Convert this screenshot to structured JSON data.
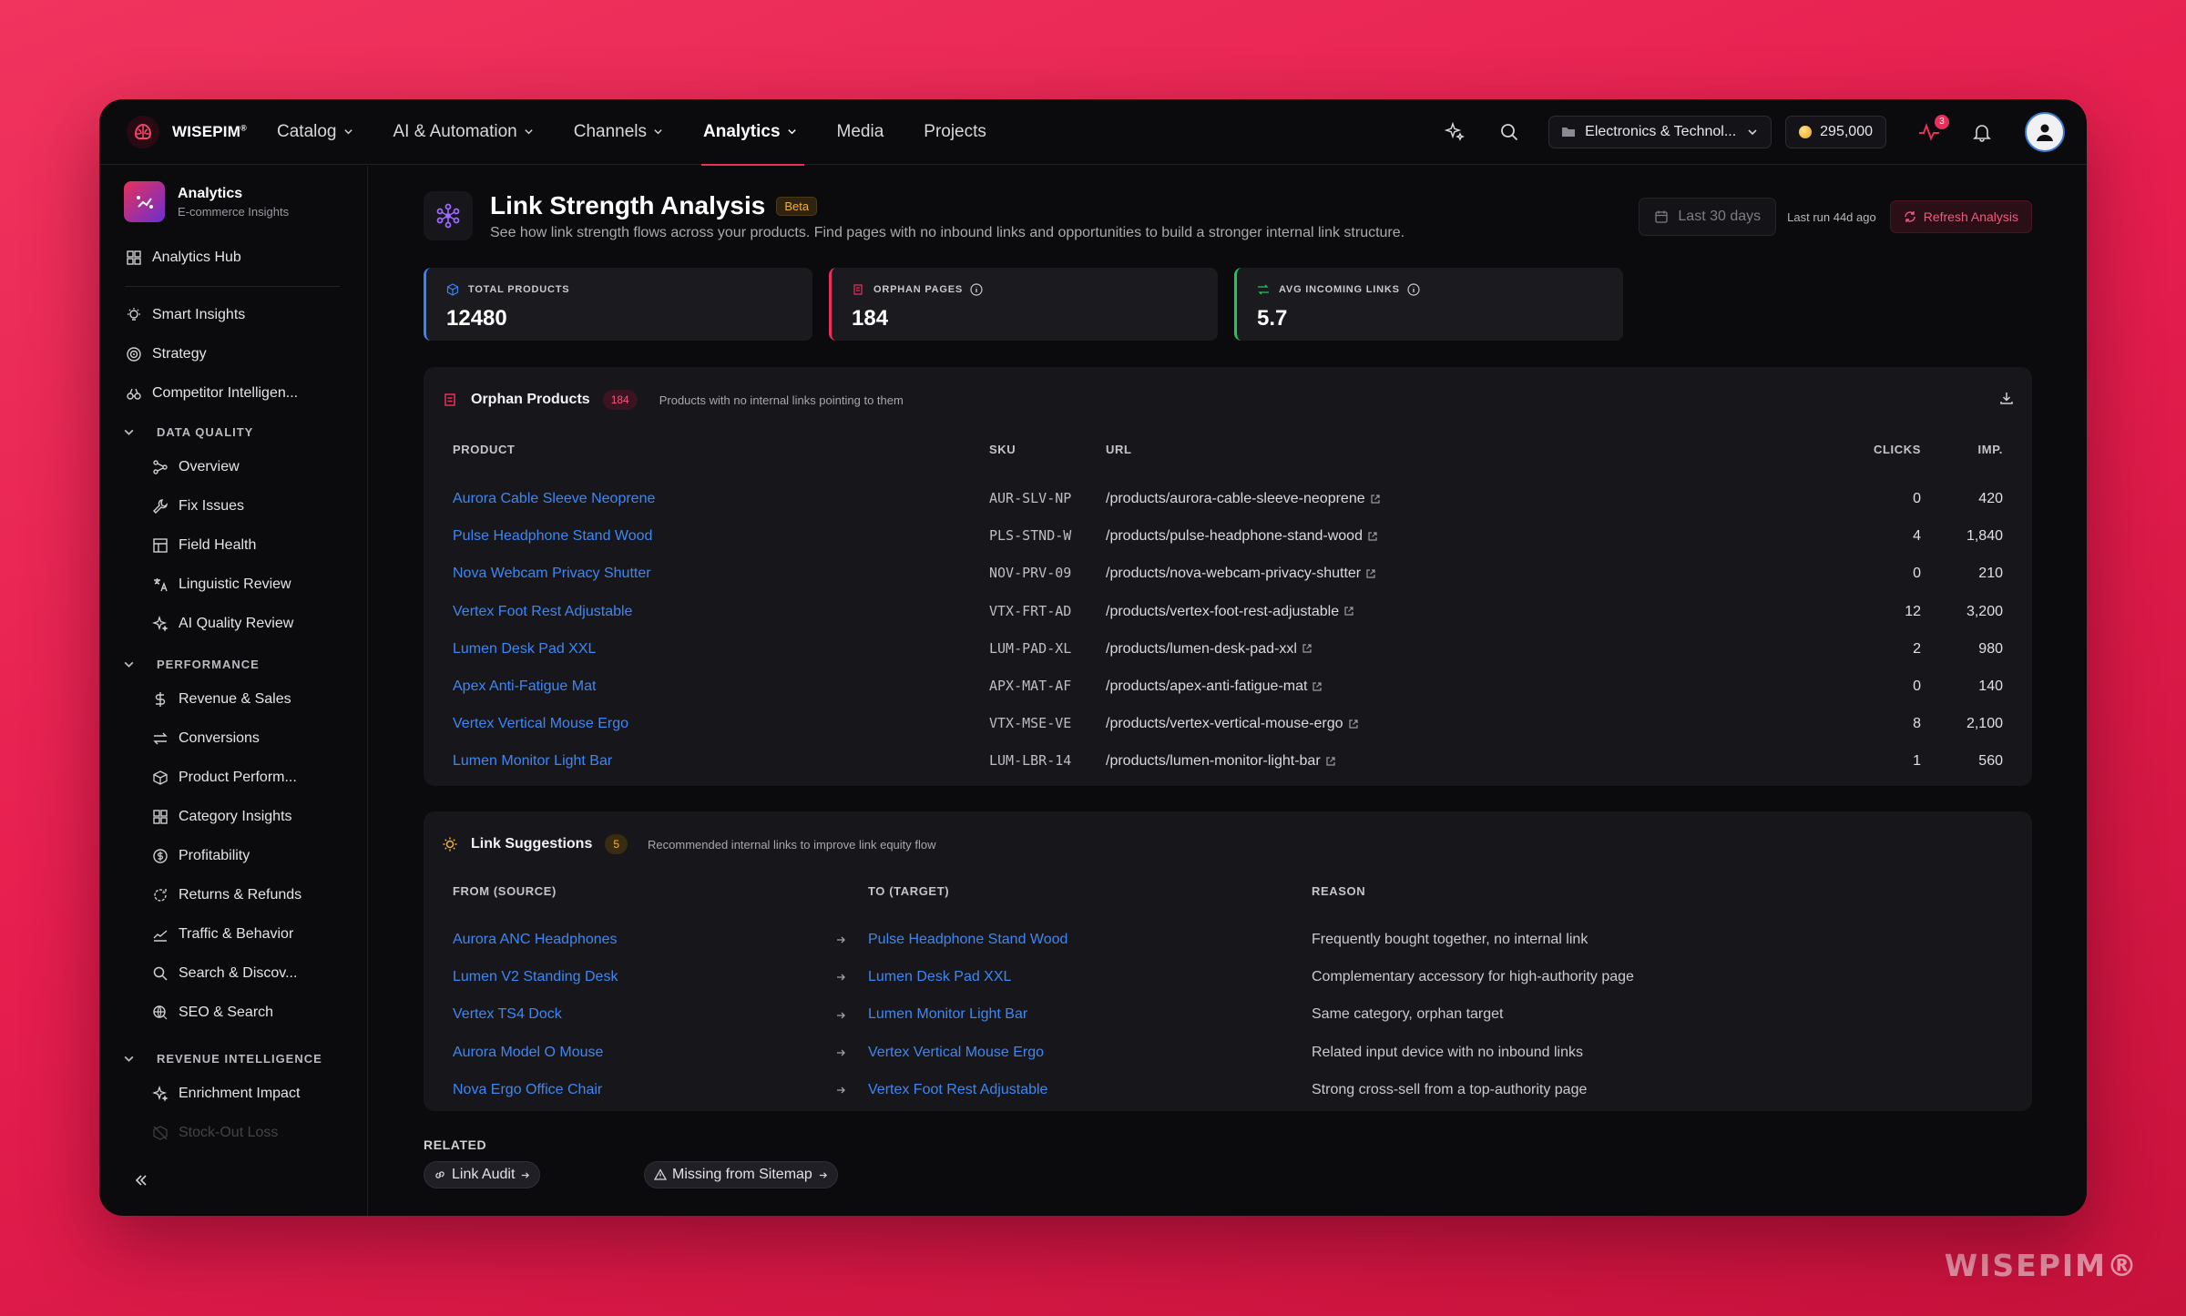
{
  "brand": {
    "name": "WISEPIM",
    "mark": "®",
    "watermark": "WISEPIM®"
  },
  "nav": {
    "items": [
      {
        "label": "Catalog",
        "dropdown": true
      },
      {
        "label": "AI & Automation",
        "dropdown": true
      },
      {
        "label": "Channels",
        "dropdown": true
      },
      {
        "label": "Analytics",
        "dropdown": true,
        "active": true
      },
      {
        "label": "Media",
        "dropdown": false
      },
      {
        "label": "Projects",
        "dropdown": false
      }
    ]
  },
  "topbar": {
    "workspace": "Electronics & Technol...",
    "credits": "295,000",
    "notification_count": "3"
  },
  "sidebar": {
    "title": "Analytics",
    "subtitle": "E-commerce Insights",
    "hub": "Analytics Hub",
    "top_items": [
      "Smart Insights",
      "Strategy",
      "Competitor Intelligen..."
    ],
    "sections": [
      {
        "label": "DATA QUALITY",
        "items": [
          "Overview",
          "Fix Issues",
          "Field Health",
          "Linguistic Review",
          "AI Quality Review"
        ]
      },
      {
        "label": "PERFORMANCE",
        "items": [
          "Revenue & Sales",
          "Conversions",
          "Product Perform...",
          "Category Insights",
          "Profitability",
          "Returns & Refunds",
          "Traffic & Behavior",
          "Search & Discov...",
          "SEO & Search"
        ]
      },
      {
        "label": "REVENUE INTELLIGENCE",
        "items": [
          "Enrichment Impact",
          "Stock-Out Loss"
        ]
      }
    ]
  },
  "page": {
    "title": "Link Strength Analysis",
    "badge": "Beta",
    "description": "See how link strength flows across your products. Find pages with no inbound links and opportunities to build a stronger internal link structure.",
    "date_range": "Last 30 days",
    "last_run": "Last run 44d ago",
    "refresh_label": "Refresh Analysis"
  },
  "kpis": [
    {
      "label": "TOTAL PRODUCTS",
      "value": "12480",
      "color": "#3b82f6"
    },
    {
      "label": "ORPHAN PAGES",
      "value": "184",
      "color": "#e8305a"
    },
    {
      "label": "AVG INCOMING LINKS",
      "value": "5.7",
      "color": "#22c55e"
    }
  ],
  "orphans": {
    "title": "Orphan Products",
    "count": "184",
    "subtitle": "Products with no internal links pointing to them",
    "columns": [
      "PRODUCT",
      "SKU",
      "URL",
      "CLICKS",
      "IMP."
    ],
    "rows": [
      {
        "product": "Aurora Cable Sleeve Neoprene",
        "sku": "AUR-SLV-NP",
        "url": "/products/aurora-cable-sleeve-neoprene",
        "clicks": "0",
        "imp": "420"
      },
      {
        "product": "Pulse Headphone Stand Wood",
        "sku": "PLS-STND-W",
        "url": "/products/pulse-headphone-stand-wood",
        "clicks": "4",
        "imp": "1,840"
      },
      {
        "product": "Nova Webcam Privacy Shutter",
        "sku": "NOV-PRV-09",
        "url": "/products/nova-webcam-privacy-shutter",
        "clicks": "0",
        "imp": "210"
      },
      {
        "product": "Vertex Foot Rest Adjustable",
        "sku": "VTX-FRT-AD",
        "url": "/products/vertex-foot-rest-adjustable",
        "clicks": "12",
        "imp": "3,200"
      },
      {
        "product": "Lumen Desk Pad XXL",
        "sku": "LUM-PAD-XL",
        "url": "/products/lumen-desk-pad-xxl",
        "clicks": "2",
        "imp": "980"
      },
      {
        "product": "Apex Anti-Fatigue Mat",
        "sku": "APX-MAT-AF",
        "url": "/products/apex-anti-fatigue-mat",
        "clicks": "0",
        "imp": "140"
      },
      {
        "product": "Vertex Vertical Mouse Ergo",
        "sku": "VTX-MSE-VE",
        "url": "/products/vertex-vertical-mouse-ergo",
        "clicks": "8",
        "imp": "2,100"
      },
      {
        "product": "Lumen Monitor Light Bar",
        "sku": "LUM-LBR-14",
        "url": "/products/lumen-monitor-light-bar",
        "clicks": "1",
        "imp": "560"
      }
    ]
  },
  "suggestions": {
    "title": "Link Suggestions",
    "count": "5",
    "subtitle": "Recommended internal links to improve link equity flow",
    "columns": [
      "FROM (SOURCE)",
      "TO (TARGET)",
      "REASON"
    ],
    "rows": [
      {
        "from": "Aurora ANC Headphones",
        "to": "Pulse Headphone Stand Wood",
        "reason": "Frequently bought together, no internal link"
      },
      {
        "from": "Lumen V2 Standing Desk",
        "to": "Lumen Desk Pad XXL",
        "reason": "Complementary accessory for high-authority page"
      },
      {
        "from": "Vertex TS4 Dock",
        "to": "Lumen Monitor Light Bar",
        "reason": "Same category, orphan target"
      },
      {
        "from": "Aurora Model O Mouse",
        "to": "Vertex Vertical Mouse Ergo",
        "reason": "Related input device with no inbound links"
      },
      {
        "from": "Nova Ergo Office Chair",
        "to": "Vertex Foot Rest Adjustable",
        "reason": "Strong cross-sell from a top-authority page"
      }
    ]
  },
  "related": {
    "label": "RELATED",
    "links": [
      "Link Audit",
      "Missing from Sitemap"
    ]
  },
  "colors": {
    "accent": "#e8305a",
    "link": "#3f86f2",
    "window": "#0b0b0d",
    "card": "#17171b"
  }
}
